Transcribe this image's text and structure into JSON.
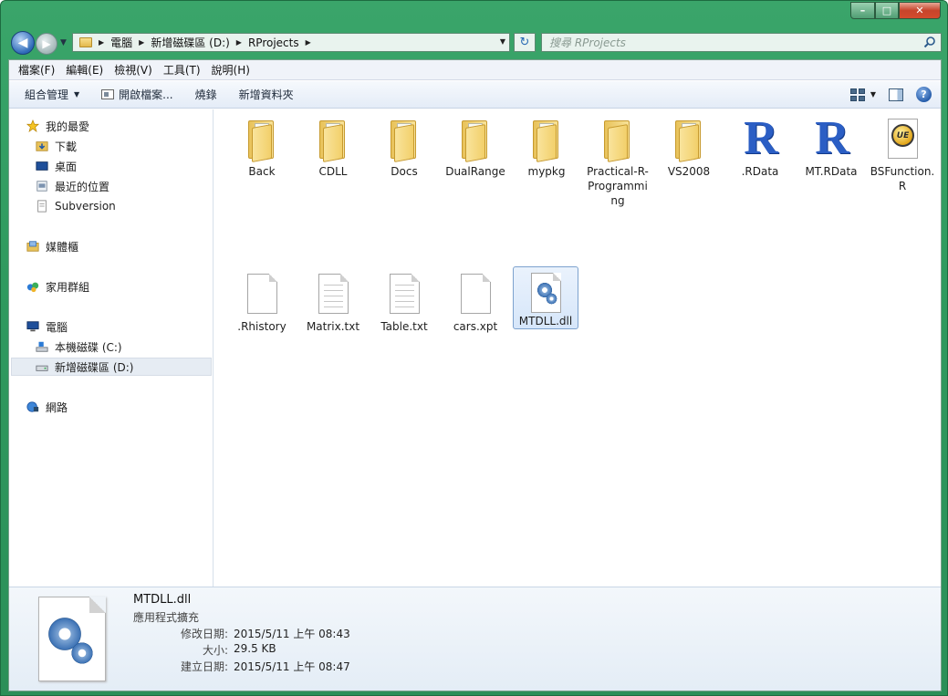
{
  "window": {
    "caption_buttons": {
      "minimize": "–",
      "maximize": "□",
      "close": "✕"
    }
  },
  "address_bar": {
    "crumbs": [
      "電腦",
      "新增磁碟區 (D:)",
      "RProjects"
    ]
  },
  "search": {
    "placeholder": "搜尋 RProjects"
  },
  "menu": [
    "檔案(F)",
    "編輯(E)",
    "檢視(V)",
    "工具(T)",
    "說明(H)"
  ],
  "toolbar": {
    "organize": "組合管理",
    "open_file": "開啟檔案...",
    "burn": "燒錄",
    "new_folder": "新增資料夾"
  },
  "nav": {
    "favorites": "我的最愛",
    "downloads": "下載",
    "desktop": "桌面",
    "recent": "最近的位置",
    "subversion": "Subversion",
    "libraries": "媒體櫃",
    "homegroup": "家用群組",
    "computer": "電腦",
    "drive_c": "本機磁碟 (C:)",
    "drive_d": "新增磁碟區 (D:)",
    "network": "網路"
  },
  "files": [
    {
      "name": "Back",
      "kind": "folder"
    },
    {
      "name": "CDLL",
      "kind": "folder"
    },
    {
      "name": "Docs",
      "kind": "folder"
    },
    {
      "name": "DualRange",
      "kind": "folder"
    },
    {
      "name": "mypkg",
      "kind": "folder"
    },
    {
      "name": "Practical-R-Programming",
      "kind": "folder"
    },
    {
      "name": "VS2008",
      "kind": "folder"
    },
    {
      "name": ".RData",
      "kind": "r-data"
    },
    {
      "name": "MT.RData",
      "kind": "r-data"
    },
    {
      "name": "BSFunction.R",
      "kind": "ue-file"
    },
    {
      "name": ".Rhistory",
      "kind": "document"
    },
    {
      "name": "Matrix.txt",
      "kind": "text"
    },
    {
      "name": "Table.txt",
      "kind": "text"
    },
    {
      "name": "cars.xpt",
      "kind": "document"
    },
    {
      "name": "MTDLL.dll",
      "kind": "dll",
      "selected": true
    }
  ],
  "details": {
    "name": "MTDLL.dll",
    "type": "應用程式擴充",
    "modified_label": "修改日期:",
    "modified": "2015/5/11 上午 08:43",
    "size_label": "大小:",
    "size": "29.5 KB",
    "created_label": "建立日期:",
    "created": "2015/5/11 上午 08:47"
  }
}
